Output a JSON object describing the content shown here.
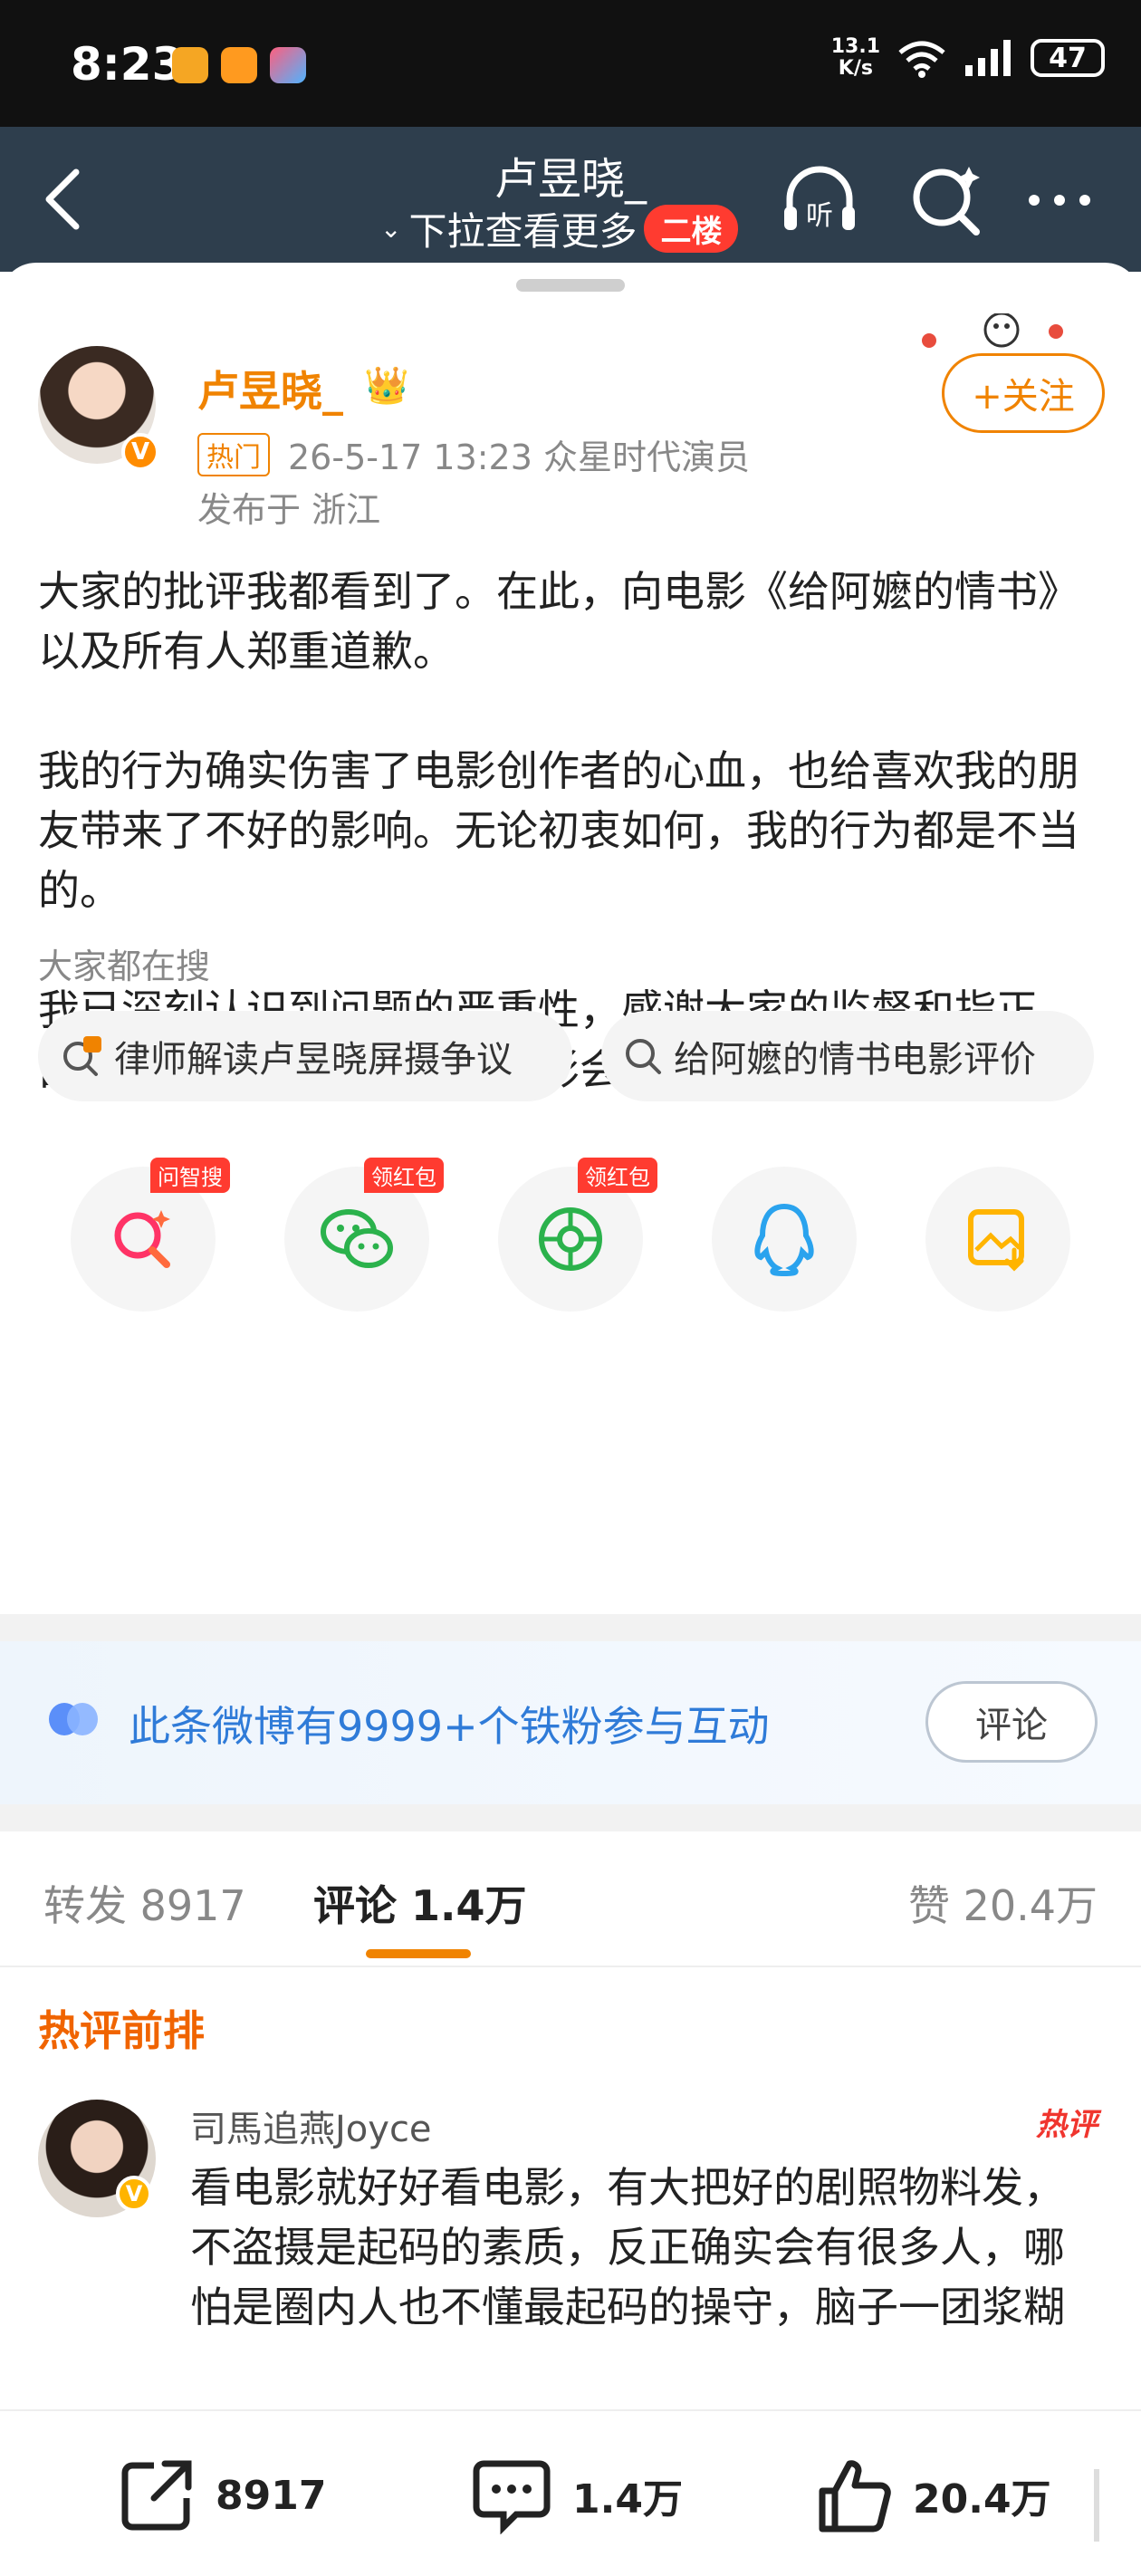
{
  "status_bar": {
    "time": "8:23",
    "net_speed_value": "13.1",
    "net_speed_unit": "K/s",
    "battery": "47",
    "apps": [
      {
        "name": "weibo-app-icon",
        "color": "#f5a623"
      },
      {
        "name": "task-app-icon",
        "color": "#ff9a1f"
      },
      {
        "name": "flag-app-icon",
        "color": "#e84c6f"
      }
    ]
  },
  "nav": {
    "title": "卢昱晓_",
    "subtitle": "下拉查看更多",
    "badge": "二楼",
    "listen_label": "听"
  },
  "post": {
    "author": "卢昱晓_",
    "hot_tag": "热门",
    "time_source": "26-5-17 13:23  众星时代演员",
    "location": "发布于 浙江",
    "follow_label": "+关注",
    "verified": "V",
    "paragraphs": [
      "大家的批评我都看到了。在此，向电影《给阿嬷的情书》以及所有人郑重道歉。",
      "我的行为确实伤害了电影创作者的心血，也给喜欢我的朋友带来了不好的影响。无论初衷如何，我的行为都是不当的。",
      "我已深刻认识到问题的严重性，感谢大家的监督和指正。由衷希望这部有温度的好电影会被更多人看到。"
    ]
  },
  "search": {
    "label": "大家都在搜",
    "chips": [
      "律师解读卢昱晓屏摄争议",
      "给阿嬷的情书电影评价"
    ]
  },
  "share": {
    "items": [
      {
        "name": "ask-search",
        "tag": "问智搜"
      },
      {
        "name": "wechat",
        "tag": "领红包"
      },
      {
        "name": "moments",
        "tag": "领红包"
      },
      {
        "name": "qq",
        "tag": ""
      },
      {
        "name": "save-image",
        "tag": ""
      }
    ]
  },
  "fans": {
    "text": "此条微博有9999+个铁粉参与互动",
    "button": "评论"
  },
  "tabs": {
    "repost": "转发 8917",
    "comment": "评论 1.4万",
    "like": "赞 20.4万"
  },
  "comments": {
    "section_title": "热评前排",
    "items": [
      {
        "name": "司馬追燕Joyce",
        "badge": "热评",
        "verified": "V",
        "text": "看电影就好好看电影，有大把好的剧照物料发，不盗摄是起码的素质，反正确实会有很多人，哪怕是圈内人也不懂最起码的操守，脑子一团浆糊"
      }
    ]
  },
  "bottom_bar": {
    "repost": "8917",
    "comment": "1.4万",
    "like": "20.4万"
  },
  "colors": {
    "accent": "#f08300",
    "nav_bg": "#2e3e4d",
    "link_blue": "#2f7bd8",
    "hot_red": "#f0352e"
  }
}
